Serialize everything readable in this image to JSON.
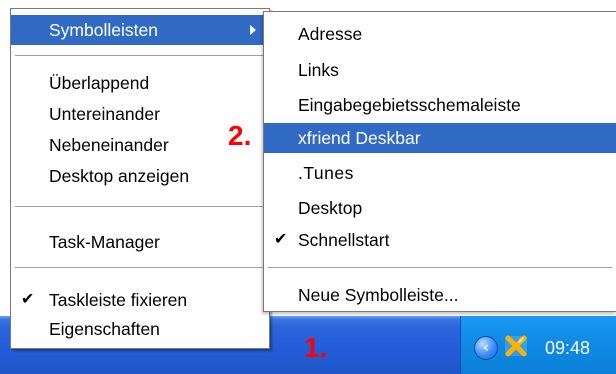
{
  "taskbar": {
    "clock": "09:48",
    "tray_icons": [
      "chevron-left-icon",
      "xfriend-icon"
    ]
  },
  "context_menu": {
    "items": [
      {
        "label": "Symbolleisten",
        "checked": false,
        "has_submenu": true,
        "selected": true
      },
      {
        "label": "Überlappend",
        "checked": false
      },
      {
        "label": "Untereinander",
        "checked": false
      },
      {
        "label": "Nebeneinander",
        "checked": false
      },
      {
        "label": "Desktop anzeigen",
        "checked": false
      },
      {
        "label": "Task-Manager",
        "checked": false
      },
      {
        "label": "Taskleiste fixieren",
        "checked": true
      },
      {
        "label": "Eigenschaften",
        "checked": false
      }
    ]
  },
  "submenu": {
    "items": [
      {
        "label": "Adresse",
        "checked": false
      },
      {
        "label": "Links",
        "checked": false
      },
      {
        "label": "Eingabegebietsschemaleiste",
        "checked": false
      },
      {
        "label": "xfriend Deskbar",
        "checked": false,
        "selected": true
      },
      {
        "label": ".Tunes",
        "checked": false
      },
      {
        "label": "Desktop",
        "checked": false
      },
      {
        "label": "Schnellstart",
        "checked": true
      },
      {
        "label": "Neue Symbolleiste...",
        "checked": false
      }
    ]
  },
  "annotations": {
    "step1": "1.",
    "step2": "2."
  },
  "colors": {
    "taskbar_blue": "#245edb",
    "tray_blue": "#0f8ce6",
    "menu_selection": "#316ac5",
    "annotation_red": "#ff0000"
  }
}
